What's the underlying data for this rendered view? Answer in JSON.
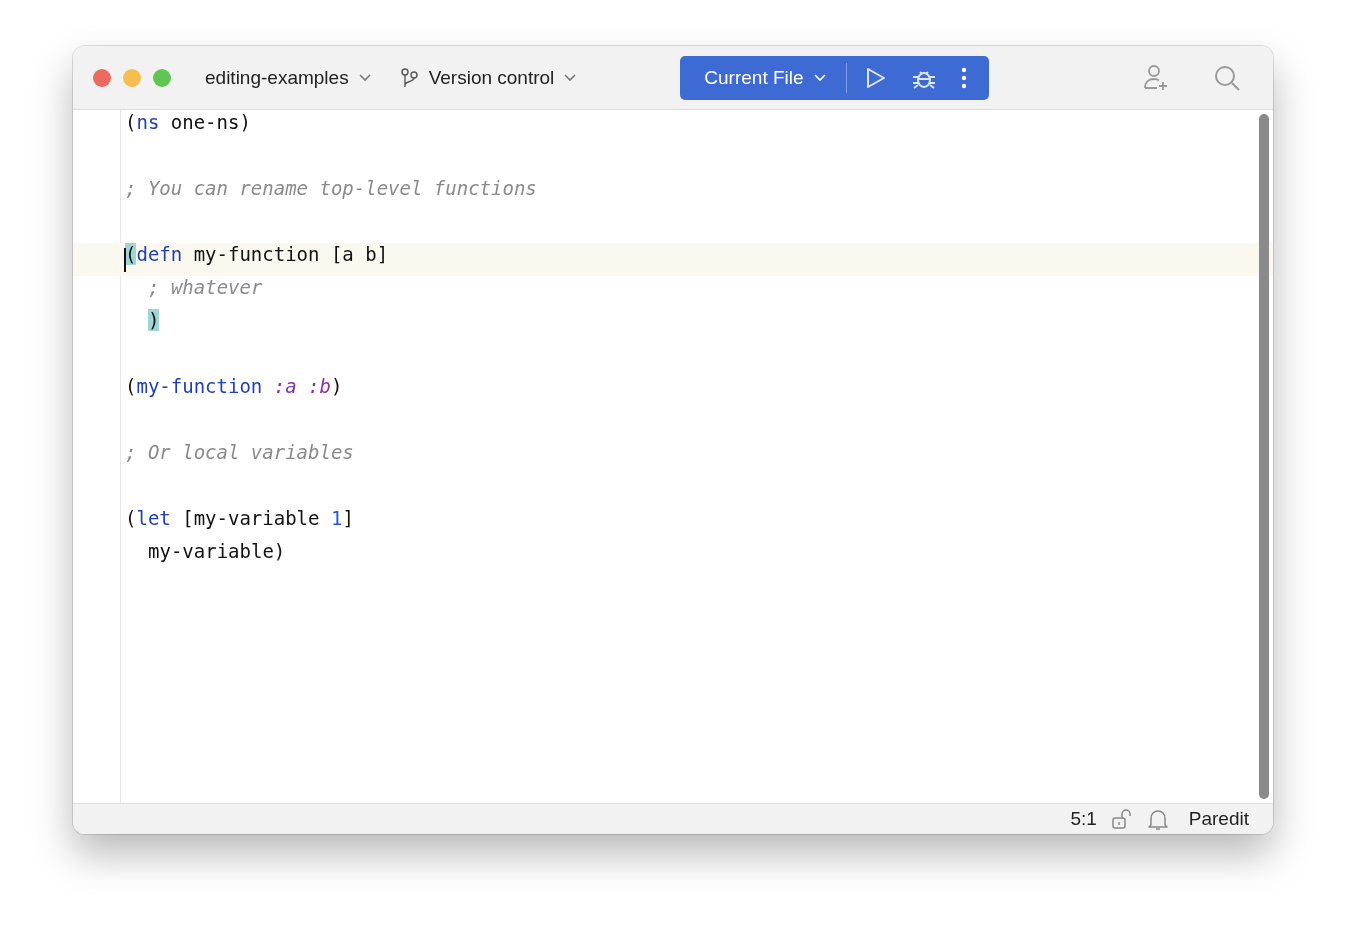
{
  "window": {
    "project": "editing-examples",
    "vcs": "Version control",
    "run_config": "Current File"
  },
  "editor": {
    "lines": [
      {
        "current": false,
        "tokens": [
          {
            "kind": "plain",
            "text": "("
          },
          {
            "kind": "keyword",
            "text": "ns"
          },
          {
            "kind": "plain",
            "text": " one-ns)"
          }
        ]
      },
      {
        "current": false
      },
      {
        "current": false,
        "tokens": [
          {
            "kind": "comment",
            "text": "; You can rename top-level functions"
          }
        ]
      },
      {
        "current": false
      },
      {
        "current": true,
        "caret": true,
        "tokens": [
          {
            "kind": "matched",
            "text": "("
          },
          {
            "kind": "keyword",
            "text": "defn"
          },
          {
            "kind": "plain",
            "text": " my-function [a b]"
          }
        ]
      },
      {
        "current": false,
        "indented": true,
        "tokens": [
          {
            "kind": "comment",
            "text": "; whatever"
          }
        ]
      },
      {
        "current": false,
        "indented": true,
        "tokens": [
          {
            "kind": "matched",
            "text": ")"
          }
        ]
      },
      {
        "current": false
      },
      {
        "current": false,
        "tokens": [
          {
            "kind": "plain",
            "text": "("
          },
          {
            "kind": "keyword",
            "text": "my-function"
          },
          {
            "kind": "argument",
            "text": " :a :b"
          },
          {
            "kind": "plain",
            "text": ")"
          }
        ]
      },
      {
        "current": false
      },
      {
        "current": false,
        "tokens": [
          {
            "kind": "comment",
            "text": "; Or local variables"
          }
        ]
      },
      {
        "current": false
      },
      {
        "current": false,
        "tokens": [
          {
            "kind": "plain",
            "text": "("
          },
          {
            "kind": "keyword",
            "text": "let"
          },
          {
            "kind": "plain",
            "text": " [my-variable "
          },
          {
            "kind": "number",
            "text": "1"
          },
          {
            "kind": "plain",
            "text": "]"
          }
        ]
      },
      {
        "current": false,
        "indented": true,
        "tokens": [
          {
            "kind": "plain",
            "text": "my-variable)"
          }
        ]
      }
    ]
  },
  "status_bar": {
    "position": "5:1",
    "mode": "Paredit"
  }
}
